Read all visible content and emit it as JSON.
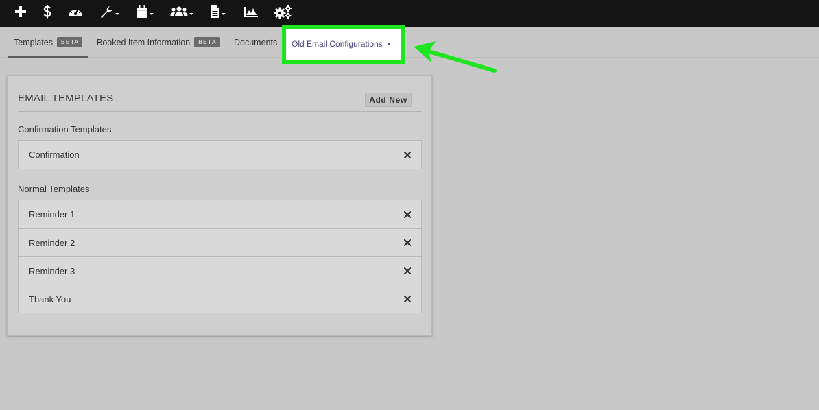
{
  "toolbar": {
    "icons": [
      {
        "name": "plus-icon",
        "has_caret": false
      },
      {
        "name": "dollar-icon",
        "has_caret": false
      },
      {
        "name": "dashboard-icon",
        "has_caret": false
      },
      {
        "name": "wrench-icon",
        "has_caret": true
      },
      {
        "name": "calendar-icon",
        "has_caret": true
      },
      {
        "name": "users-icon",
        "has_caret": true
      },
      {
        "name": "document-icon",
        "has_caret": true
      },
      {
        "name": "area-chart-icon",
        "has_caret": false
      },
      {
        "name": "gears-icon",
        "has_caret": false
      }
    ],
    "icon_color": "#ffffff",
    "background": "#141414"
  },
  "tabs": [
    {
      "label": "Templates",
      "badge": "BETA",
      "active": true
    },
    {
      "label": "Booked Item Information",
      "badge": "BETA",
      "active": false
    },
    {
      "label": "Documents",
      "badge": "",
      "active": false
    },
    {
      "label": "Old Email Configurations",
      "badge": "",
      "active": false,
      "has_dropdown": true,
      "highlighted": true
    }
  ],
  "annotation": {
    "highlight_color": "#1ee61e",
    "arrow_color": "#1ee61e"
  },
  "panel": {
    "title": "EMAIL TEMPLATES",
    "add_new_label": "Add New",
    "sections": [
      {
        "heading": "Confirmation Templates",
        "items": [
          "Confirmation"
        ]
      },
      {
        "heading": "Normal Templates",
        "items": [
          "Reminder 1",
          "Reminder 2",
          "Reminder 3",
          "Thank You"
        ]
      }
    ],
    "remove_symbol": "close-icon"
  }
}
